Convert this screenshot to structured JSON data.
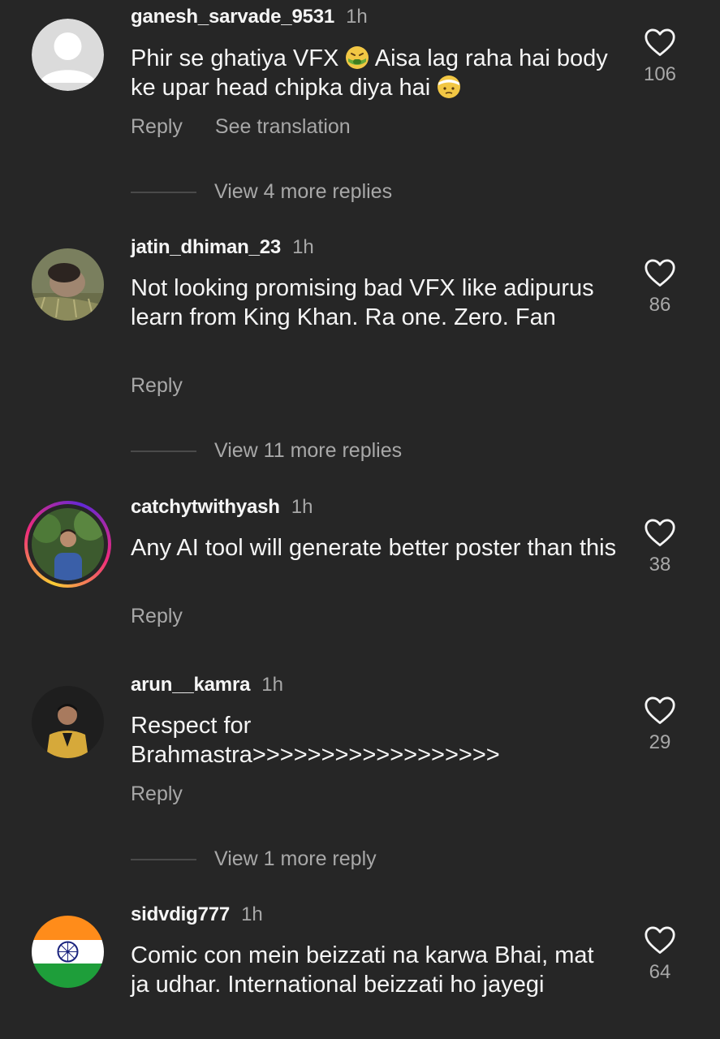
{
  "comments": [
    {
      "username": "ganesh_sarvade_9531",
      "time": "1h",
      "text_parts": [
        "Phir se ghatiya VFX ",
        " Aisa lag raha hai body ke upar head chipka diya hai "
      ],
      "emoji": [
        "face-vomiting-emoji",
        "face-with-head-bandage-emoji"
      ],
      "likes": "106",
      "reply": "Reply",
      "translate": "See translation",
      "view_replies": "View 4 more replies"
    },
    {
      "username": "jatin_dhiman_23",
      "time": "1h",
      "text": "Not looking promising bad VFX like adipurus  learn from King Khan. Ra one. Zero. Fan",
      "likes": "86",
      "reply": "Reply",
      "view_replies": "View 11 more replies"
    },
    {
      "username": "catchytwithyash",
      "time": "1h",
      "text": "Any AI tool will generate better poster than this",
      "likes": "38",
      "reply": "Reply"
    },
    {
      "username": "arun__kamra",
      "time": "1h",
      "text": "Respect for Brahmastra>>>>>>>>>>>>>>>>>>",
      "likes": "29",
      "reply": "Reply",
      "view_replies": "View 1 more reply"
    },
    {
      "username": "sidvdig777",
      "time": "1h",
      "text": "Comic con mein beizzati na karwa Bhai, mat ja udhar. International beizzati ho jayegi",
      "likes": "64"
    }
  ],
  "colors": {
    "background": "#262626",
    "primary_text": "#f5f5f5",
    "secondary_text": "#a8a8a8"
  },
  "icons": {
    "like": "heart-outline-icon",
    "default_avatar": "default-avatar-icon"
  }
}
